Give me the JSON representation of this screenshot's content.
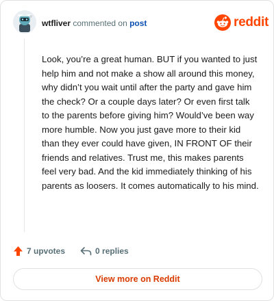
{
  "header": {
    "username": "wtfliver",
    "action_text": "commented on",
    "post_link_text": "post",
    "avatar_icon": "snoo-avatar-icon"
  },
  "logo": {
    "wordmark": "reddit",
    "icon": "reddit-snoo-icon",
    "color": "#ff4500"
  },
  "comment": {
    "body": "Look, you’re a great human. BUT if you wanted to just help him and not make a show all around this money, why didn’t you wait until after the party and gave him the check? Or a couple days later? Or even first talk to the parents before giving him? Would’ve been way more humble. Now you just gave more to their kid than they ever could have given, IN FRONT OF their friends and relatives. Trust me, this makes parents feel very bad. And the kid immediately thinking of his parents as loosers. It comes automatically to his mind."
  },
  "actions": {
    "upvotes_label": "7 upvotes",
    "upvote_icon": "upvote-arrow-icon",
    "upvote_color": "#ff4500",
    "replies_label": "0 replies",
    "reply_icon": "reply-arrow-icon"
  },
  "footer": {
    "view_more_label": "View more on Reddit",
    "accent_color": "#d93a00"
  }
}
